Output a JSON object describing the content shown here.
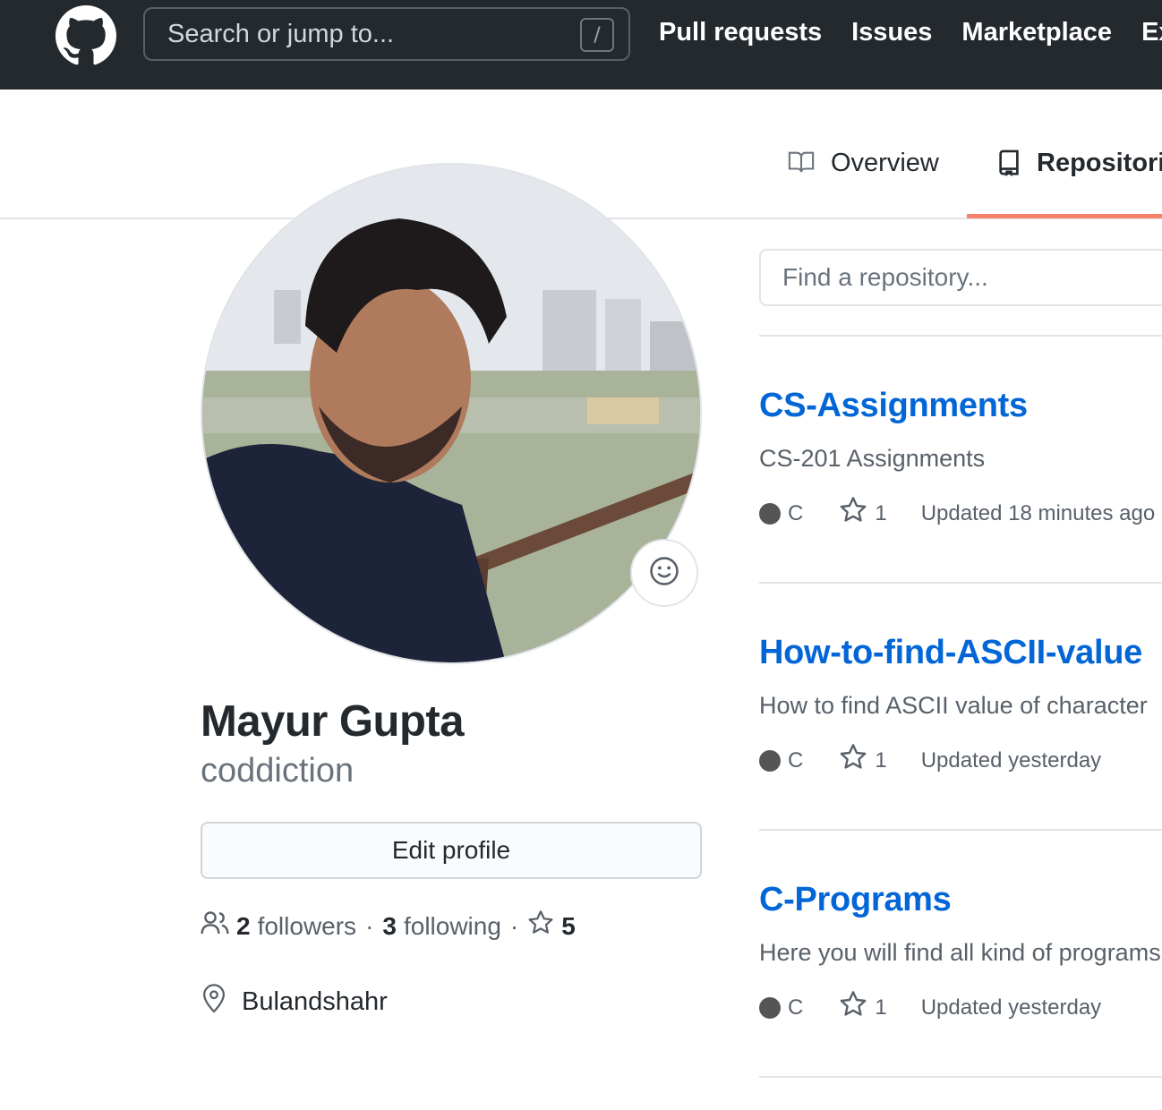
{
  "header": {
    "search_placeholder": "Search or jump to...",
    "search_key_hint": "/",
    "nav": [
      "Pull requests",
      "Issues",
      "Marketplace",
      "Explore"
    ]
  },
  "tabs": {
    "overview": "Overview",
    "repositories": "Repositories"
  },
  "profile": {
    "full_name": "Mayur Gupta",
    "username": "coddiction",
    "edit_button": "Edit profile",
    "followers_count": "2",
    "followers_label": "followers",
    "following_count": "3",
    "following_label": "following",
    "stars_count": "5",
    "location": "Bulandshahr"
  },
  "repo_search": {
    "placeholder": "Find a repository..."
  },
  "repositories": [
    {
      "name": "CS-Assignments",
      "description": "CS-201 Assignments",
      "language": "C",
      "language_color": "#555555",
      "stars": "1",
      "updated": "Updated 18 minutes ago"
    },
    {
      "name": "How-to-find-ASCII-value",
      "description": "How to find ASCII value of character",
      "language": "C",
      "language_color": "#555555",
      "stars": "1",
      "updated": "Updated yesterday"
    },
    {
      "name": "C-Programs",
      "description": "Here you will find all kind of programs",
      "language": "C",
      "language_color": "#555555",
      "stars": "1",
      "updated": "Updated yesterday"
    }
  ],
  "colors": {
    "header_bg": "#24292e",
    "link_blue": "#0366d6",
    "tab_active_underline": "#f9826c"
  }
}
